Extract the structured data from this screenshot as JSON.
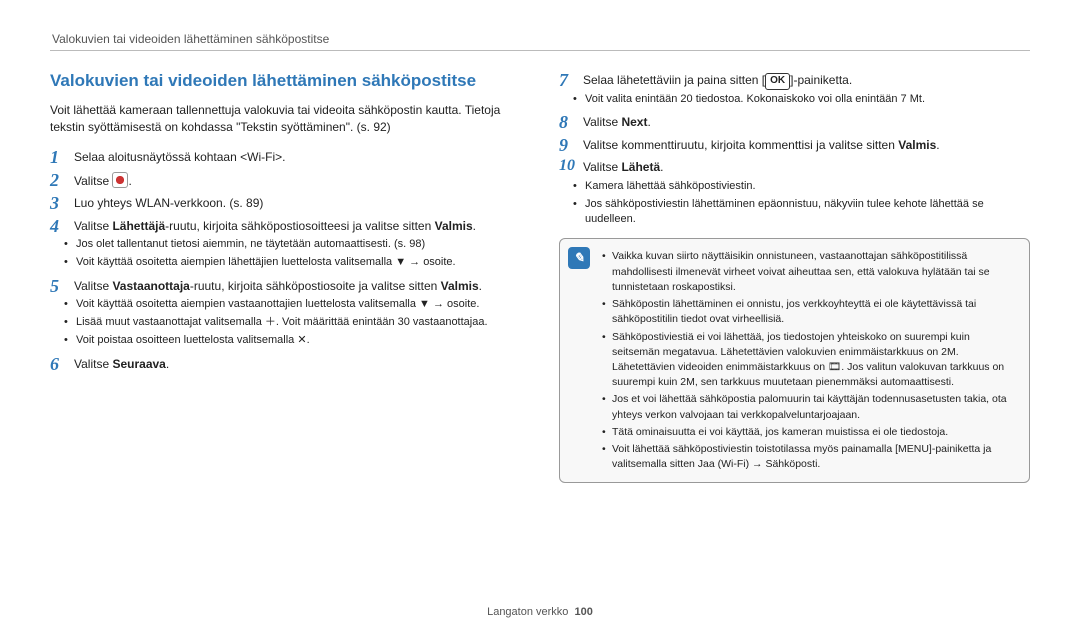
{
  "header": "Valokuvien tai videoiden lähettäminen sähköpostitse",
  "title": "Valokuvien tai videoiden lähettäminen sähköpostitse",
  "intro": "Voit lähettää kameraan tallennettuja valokuvia tai videoita sähköpostin kautta. Tietoja tekstin syöttämisestä on kohdassa \"Tekstin syöttäminen\". (s. 92)",
  "steps_left": {
    "s1": "Selaa aloitusnäytössä kohtaan <Wi-Fi>.",
    "s2": "Valitse ",
    "s2b": ".",
    "s3": "Luo yhteys WLAN-verkkoon. (s. 89)",
    "s4a": "Valitse ",
    "s4b": "Lähettäjä",
    "s4c": "-ruutu, kirjoita sähköpostiosoitteesi ja valitse sitten ",
    "s4d": "Valmis",
    "s4e": ".",
    "s4_sub": [
      "Jos olet tallentanut tietosi aiemmin, ne täytetään automaattisesti. (s. 98)",
      "Voit käyttää osoitetta aiempien lähettäjien luettelosta valitsemalla ▼ → osoite."
    ],
    "s5a": "Valitse ",
    "s5b": "Vastaanottaja",
    "s5c": "-ruutu, kirjoita sähköpostiosoite ja valitse sitten ",
    "s5d": "Valmis",
    "s5e": ".",
    "s5_sub": [
      "Voit käyttää osoitetta aiempien vastaanottajien luettelosta valitsemalla ▼ → osoite.",
      "Lisää muut vastaanottajat valitsemalla ＋. Voit määrittää enintään 30 vastaanottajaa.",
      "Voit poistaa osoitteen luettelosta valitsemalla ✕."
    ],
    "s6a": "Valitse ",
    "s6b": "Seuraava",
    "s6c": "."
  },
  "steps_right": {
    "s7a": "Selaa lähetettäviin ja paina sitten [",
    "s7b": "OK",
    "s7c": "]-painiketta.",
    "s7_sub": [
      "Voit valita enintään 20 tiedostoa. Kokonaiskoko voi olla enintään 7 Mt."
    ],
    "s8a": "Valitse ",
    "s8b": "Next",
    "s8c": ".",
    "s9a": "Valitse kommenttiruutu, kirjoita kommenttisi ja valitse sitten ",
    "s9b": "Valmis",
    "s9c": ".",
    "s10a": "Valitse ",
    "s10b": "Lähetä",
    "s10c": ".",
    "s10_sub": [
      "Kamera lähettää sähköpostiviestin.",
      "Jos sähköpostiviestin lähettäminen epäonnistuu, näkyviin tulee kehote lähettää se uudelleen."
    ]
  },
  "notebox": [
    "Vaikka kuvan siirto näyttäisikin onnistuneen, vastaanottajan sähköpostitilissä mahdollisesti ilmenevät virheet voivat aiheuttaa sen, että valokuva hylätään tai se tunnistetaan roskapostiksi.",
    "Sähköpostin lähettäminen ei onnistu, jos verkkoyhteyttä ei ole käytettävissä tai sähköpostitilin tiedot ovat virheellisiä.",
    "Sähköpostiviestiä ei voi lähettää, jos tiedostojen yhteiskoko on suurempi kuin seitsemän megatavua. Lähetettävien valokuvien enimmäistarkkuus on 2M. Lähetettävien videoiden enimmäistarkkuus on 🎞. Jos valitun valokuvan tarkkuus on suurempi kuin 2M, sen tarkkuus muutetaan pienemmäksi automaattisesti.",
    "Jos et voi lähettää sähköpostia palomuurin tai käyttäjän todennusasetusten takia, ota yhteys verkon valvojaan tai verkkopalveluntarjoajaan.",
    "Tätä ominaisuutta ei voi käyttää, jos kameran muistissa ei ole tiedostoja.",
    "Voit lähettää sähköpostiviestin toistotilassa myös painamalla [MENU]-painiketta ja valitsemalla sitten Jaa (Wi-Fi) → Sähköposti."
  ],
  "footer": {
    "section": "Langaton verkko",
    "page": "100"
  }
}
